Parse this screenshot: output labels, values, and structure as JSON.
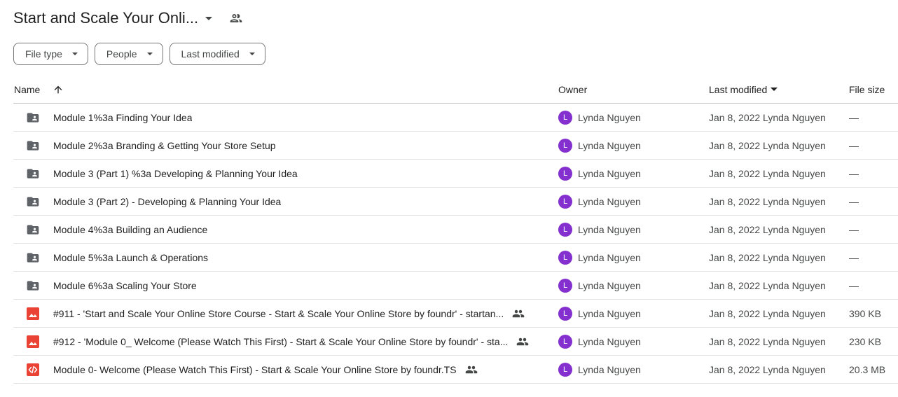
{
  "header": {
    "title": "Start and Scale Your Onli...",
    "shared_icon": "people-icon"
  },
  "filters": [
    {
      "label": "File type"
    },
    {
      "label": "People"
    },
    {
      "label": "Last modified"
    }
  ],
  "columns": {
    "name": "Name",
    "owner": "Owner",
    "last_modified": "Last modified",
    "file_size": "File size"
  },
  "colors": {
    "folder": "#5f6368",
    "image": "#ea4335",
    "code": "#ea4335",
    "avatar": "#8430ce"
  },
  "rows": [
    {
      "type": "folder",
      "name": "Module 1%3a Finding Your Idea",
      "shared": false,
      "avatar": "L",
      "owner": "Lynda Nguyen",
      "modified": "Jan 8, 2022 Lynda Nguyen",
      "size": "—"
    },
    {
      "type": "folder",
      "name": "Module 2%3a Branding & Getting Your Store Setup",
      "shared": false,
      "avatar": "L",
      "owner": "Lynda Nguyen",
      "modified": "Jan 8, 2022 Lynda Nguyen",
      "size": "—"
    },
    {
      "type": "folder",
      "name": "Module 3 (Part 1) %3a Developing & Planning Your Idea",
      "shared": false,
      "avatar": "L",
      "owner": "Lynda Nguyen",
      "modified": "Jan 8, 2022 Lynda Nguyen",
      "size": "—"
    },
    {
      "type": "folder",
      "name": "Module 3 (Part 2) - Developing & Planning Your Idea",
      "shared": false,
      "avatar": "L",
      "owner": "Lynda Nguyen",
      "modified": "Jan 8, 2022 Lynda Nguyen",
      "size": "—"
    },
    {
      "type": "folder",
      "name": "Module 4%3a Building an Audience",
      "shared": false,
      "avatar": "L",
      "owner": "Lynda Nguyen",
      "modified": "Jan 8, 2022 Lynda Nguyen",
      "size": "—"
    },
    {
      "type": "folder",
      "name": "Module 5%3a Launch & Operations",
      "shared": false,
      "avatar": "L",
      "owner": "Lynda Nguyen",
      "modified": "Jan 8, 2022 Lynda Nguyen",
      "size": "—"
    },
    {
      "type": "folder",
      "name": "Module 6%3a Scaling Your Store",
      "shared": false,
      "avatar": "L",
      "owner": "Lynda Nguyen",
      "modified": "Jan 8, 2022 Lynda Nguyen",
      "size": "—"
    },
    {
      "type": "image",
      "name": "#911 - 'Start and Scale Your Online Store Course - Start & Scale Your Online Store by foundr' - startan...",
      "shared": true,
      "avatar": "L",
      "owner": "Lynda Nguyen",
      "modified": "Jan 8, 2022 Lynda Nguyen",
      "size": "390 KB"
    },
    {
      "type": "image",
      "name": "#912 - 'Module 0_ Welcome (Please Watch This First) - Start & Scale Your Online Store by foundr' - sta...",
      "shared": true,
      "avatar": "L",
      "owner": "Lynda Nguyen",
      "modified": "Jan 8, 2022 Lynda Nguyen",
      "size": "230 KB"
    },
    {
      "type": "code",
      "name": "Module 0- Welcome (Please Watch This First) - Start & Scale Your Online Store by foundr.TS",
      "shared": true,
      "avatar": "L",
      "owner": "Lynda Nguyen",
      "modified": "Jan 8, 2022 Lynda Nguyen",
      "size": "20.3 MB"
    }
  ]
}
